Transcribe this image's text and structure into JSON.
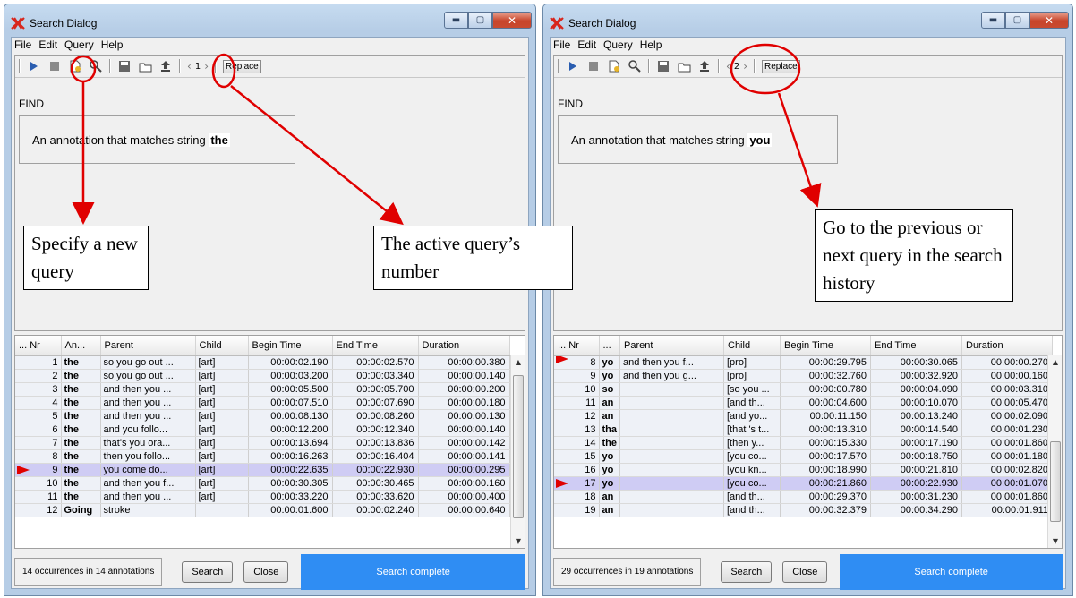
{
  "accent": "#e00000",
  "selection_color": "#cfccf4",
  "status_color": "#2f8df3",
  "windows": [
    {
      "title": "Search Dialog",
      "menu": [
        "File",
        "Edit",
        "Query",
        "Help"
      ],
      "query_number": "1",
      "replace_label": "Replace",
      "find_label": "FIND",
      "query_text": "An annotation that matches string",
      "query_term": "the",
      "columns": [
        "... Nr",
        "An...",
        "Parent",
        "Child",
        "Begin Time",
        "End Time",
        "Duration"
      ],
      "rows": [
        {
          "nr": "1",
          "an": "the",
          "parent": "so you go out ...",
          "child": "[art]",
          "begin": "00:00:02.190",
          "end": "00:00:02.570",
          "dur": "00:00:00.380"
        },
        {
          "nr": "2",
          "an": "the",
          "parent": "so you go out ...",
          "child": "[art]",
          "begin": "00:00:03.200",
          "end": "00:00:03.340",
          "dur": "00:00:00.140"
        },
        {
          "nr": "3",
          "an": "the",
          "parent": "and then you ...",
          "child": "[art]",
          "begin": "00:00:05.500",
          "end": "00:00:05.700",
          "dur": "00:00:00.200"
        },
        {
          "nr": "4",
          "an": "the",
          "parent": "and then you ...",
          "child": "[art]",
          "begin": "00:00:07.510",
          "end": "00:00:07.690",
          "dur": "00:00:00.180"
        },
        {
          "nr": "5",
          "an": "the",
          "parent": "and then you ...",
          "child": "[art]",
          "begin": "00:00:08.130",
          "end": "00:00:08.260",
          "dur": "00:00:00.130"
        },
        {
          "nr": "6",
          "an": "the",
          "parent": "and you follo...",
          "child": "[art]",
          "begin": "00:00:12.200",
          "end": "00:00:12.340",
          "dur": "00:00:00.140"
        },
        {
          "nr": "7",
          "an": "the",
          "parent": "that's you ora...",
          "child": "[art]",
          "begin": "00:00:13.694",
          "end": "00:00:13.836",
          "dur": "00:00:00.142"
        },
        {
          "nr": "8",
          "an": "the",
          "parent": "then you follo...",
          "child": "[art]",
          "begin": "00:00:16.263",
          "end": "00:00:16.404",
          "dur": "00:00:00.141"
        },
        {
          "nr": "9",
          "an": "the",
          "parent": "you come do...",
          "child": "[art]",
          "begin": "00:00:22.635",
          "end": "00:00:22.930",
          "dur": "00:00:00.295"
        },
        {
          "nr": "10",
          "an": "the",
          "parent": "and then you f...",
          "child": "[art]",
          "begin": "00:00:30.305",
          "end": "00:00:30.465",
          "dur": "00:00:00.160"
        },
        {
          "nr": "11",
          "an": "the",
          "parent": "and then you ...",
          "child": "[art]",
          "begin": "00:00:33.220",
          "end": "00:00:33.620",
          "dur": "00:00:00.400"
        },
        {
          "nr": "12",
          "an": "Going",
          "parent": "stroke",
          "child": "",
          "begin": "00:00:01.600",
          "end": "00:00:02.240",
          "dur": "00:00:00.640"
        }
      ],
      "selected_row_nr": "9",
      "occurrences": "14 occurrences in 14 annotations",
      "search_label": "Search",
      "close_label": "Close",
      "status": "Search complete"
    },
    {
      "title": "Search Dialog",
      "menu": [
        "File",
        "Edit",
        "Query",
        "Help"
      ],
      "query_number": "2",
      "replace_label": "Replace",
      "find_label": "FIND",
      "query_text": "An annotation that matches string",
      "query_term": "you",
      "columns": [
        "... Nr",
        "...",
        "Parent",
        "Child",
        "Begin Time",
        "End Time",
        "Duration"
      ],
      "rows": [
        {
          "nr": "8",
          "an": "yo",
          "parent": "and then you f...",
          "child": "[pro]",
          "begin": "00:00:29.795",
          "end": "00:00:30.065",
          "dur": "00:00:00.270"
        },
        {
          "nr": "9",
          "an": "yo",
          "parent": "and then you g...",
          "child": "[pro]",
          "begin": "00:00:32.760",
          "end": "00:00:32.920",
          "dur": "00:00:00.160"
        },
        {
          "nr": "10",
          "an": "so",
          "parent": "",
          "child": "[so you ...",
          "begin": "00:00:00.780",
          "end": "00:00:04.090",
          "dur": "00:00:03.310"
        },
        {
          "nr": "11",
          "an": "an",
          "parent": "",
          "child": "[and th...",
          "begin": "00:00:04.600",
          "end": "00:00:10.070",
          "dur": "00:00:05.470"
        },
        {
          "nr": "12",
          "an": "an",
          "parent": "",
          "child": "[and yo...",
          "begin": "00:00:11.150",
          "end": "00:00:13.240",
          "dur": "00:00:02.090"
        },
        {
          "nr": "13",
          "an": "tha",
          "parent": "",
          "child": "[that 's t...",
          "begin": "00:00:13.310",
          "end": "00:00:14.540",
          "dur": "00:00:01.230"
        },
        {
          "nr": "14",
          "an": "the",
          "parent": "",
          "child": "[then y...",
          "begin": "00:00:15.330",
          "end": "00:00:17.190",
          "dur": "00:00:01.860"
        },
        {
          "nr": "15",
          "an": "yo",
          "parent": "",
          "child": "[you co...",
          "begin": "00:00:17.570",
          "end": "00:00:18.750",
          "dur": "00:00:01.180"
        },
        {
          "nr": "16",
          "an": "yo",
          "parent": "",
          "child": "[you kn...",
          "begin": "00:00:18.990",
          "end": "00:00:21.810",
          "dur": "00:00:02.820"
        },
        {
          "nr": "17",
          "an": "yo",
          "parent": "",
          "child": "[you co...",
          "begin": "00:00:21.860",
          "end": "00:00:22.930",
          "dur": "00:00:01.070"
        },
        {
          "nr": "18",
          "an": "an",
          "parent": "",
          "child": "[and th...",
          "begin": "00:00:29.370",
          "end": "00:00:31.230",
          "dur": "00:00:01.860"
        },
        {
          "nr": "19",
          "an": "an",
          "parent": "",
          "child": "[and th...",
          "begin": "00:00:32.379",
          "end": "00:00:34.290",
          "dur": "00:00:01.911"
        }
      ],
      "selected_row_nr": "17",
      "occurrences": "29 occurrences in 19 annotations",
      "search_label": "Search",
      "close_label": "Close",
      "status": "Search complete"
    }
  ],
  "callouts": {
    "new_query": "Specify a new query",
    "active_number": "The active query’s number",
    "history": "Go to the previous or next query in the search history"
  }
}
